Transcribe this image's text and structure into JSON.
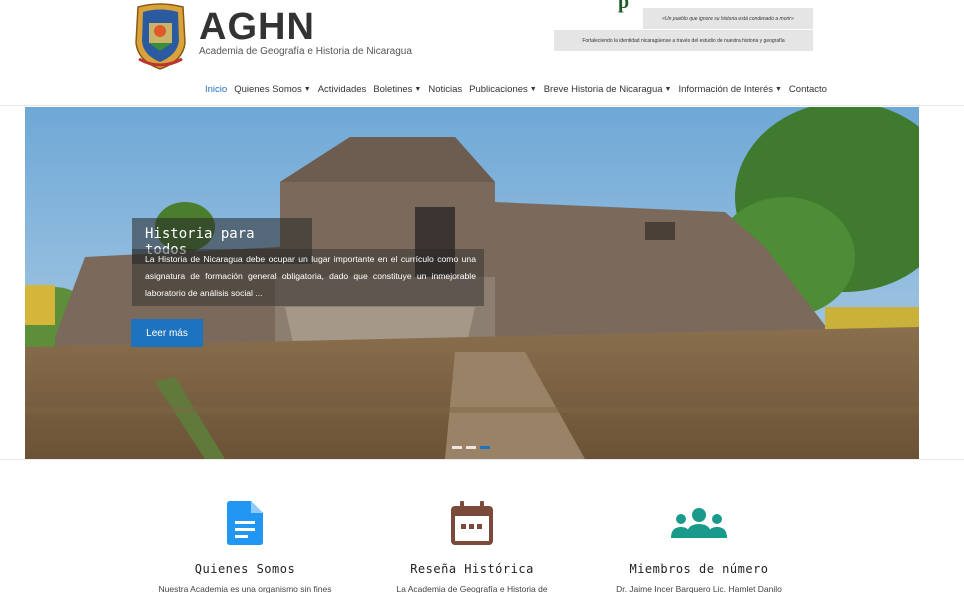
{
  "header": {
    "title": "AGHN",
    "tagline": "Academia de Geografía e Historia de Nicaragua",
    "green_fragment": "p",
    "quote1": "«Un pueblo que ignore su historia está condenado a morir»",
    "quote2": "Fortaleciendo la identidad nicaragüense a través del estudio de nuestra historia y geografía"
  },
  "nav": {
    "items": [
      {
        "label": "Inicio",
        "dropdown": false,
        "active": true
      },
      {
        "label": "Quienes Somos",
        "dropdown": true,
        "active": false
      },
      {
        "label": "Actividades",
        "dropdown": false,
        "active": false
      },
      {
        "label": "Boletines",
        "dropdown": true,
        "active": false
      },
      {
        "label": "Noticias",
        "dropdown": false,
        "active": false
      },
      {
        "label": "Publicaciones",
        "dropdown": true,
        "active": false
      },
      {
        "label": "Breve Historia de Nicaragua",
        "dropdown": true,
        "active": false
      },
      {
        "label": "Información de Interés",
        "dropdown": true,
        "active": false
      },
      {
        "label": "Contacto",
        "dropdown": false,
        "active": false
      }
    ],
    "caret": "▼"
  },
  "slider": {
    "title": "Historia para todos",
    "text": "La Historia de Nicaragua debe ocupar un lugar importante en el currículo como una asignatura de formación general obligatoria, dado que constituye un inmejorable laboratorio de análisis social ...",
    "button": "Leer más",
    "active_slide": 3,
    "slide_count": 3
  },
  "features": [
    {
      "title": "Quienes Somos",
      "text": "Nuestra Academia es una organismo sin fines",
      "icon": "document-icon",
      "color": "#2196f3"
    },
    {
      "title": "Reseña Histórica",
      "text": "La Academia de Geografía e Historia de",
      "icon": "calendar-icon",
      "color": "#7b4a3a"
    },
    {
      "title": "Miembros de número",
      "text": "Dr. Jaime Incer Barquero Lic. Hamlet Danilo",
      "icon": "people-icon",
      "color": "#1a9a8a"
    }
  ],
  "colors": {
    "accent": "#1e73be"
  }
}
